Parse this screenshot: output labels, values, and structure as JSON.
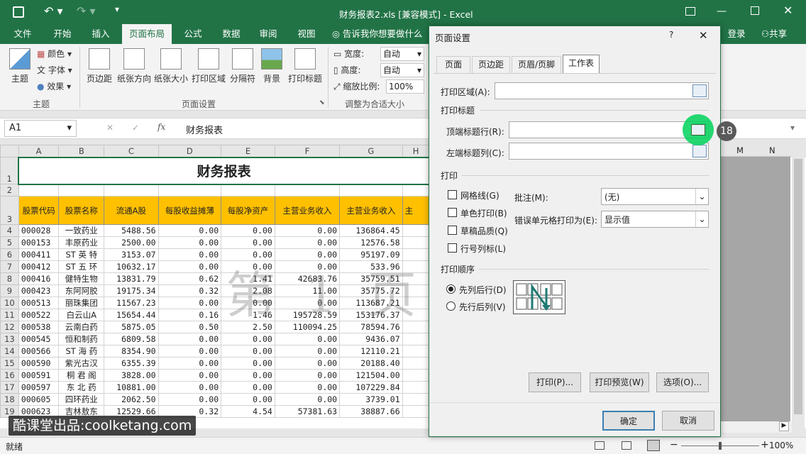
{
  "window": {
    "title": "财务报表2.xls  [兼容模式] - Excel"
  },
  "tabs": [
    "文件",
    "开始",
    "插入",
    "页面布局",
    "公式",
    "数据",
    "审阅",
    "视图"
  ],
  "tell_me": "告诉我你想要做什么",
  "login": "登录",
  "share": "共享",
  "ribbon": {
    "theme": {
      "themes": "主题",
      "colors": "颜色",
      "fonts": "字体",
      "effects": "效果",
      "group": "主题"
    },
    "page_setup": {
      "margins": "页边距",
      "orientation": "纸张方向",
      "size": "纸张大小",
      "print_area": "打印区域",
      "breaks": "分隔符",
      "background": "背景",
      "print_titles": "打印标题",
      "group": "页面设置"
    },
    "scale": {
      "width_label": "宽度:",
      "width_value": "自动",
      "height_label": "高度:",
      "height_value": "自动",
      "scale_label": "缩放比例:",
      "scale_value": "100%",
      "group": "调整为合适大小"
    }
  },
  "formula": {
    "name_box": "A1",
    "fx": "fx",
    "content": "财务报表"
  },
  "sheet": {
    "columns": [
      "A",
      "B",
      "C",
      "D",
      "E",
      "F",
      "G",
      "H"
    ],
    "title": "财务报表",
    "headers": [
      "股票代码",
      "股票名称",
      "流通A股",
      "每股收益摊薄",
      "每股净资产",
      "主营业务收入",
      "主营业务收入",
      "主"
    ],
    "rows": [
      {
        "n": "4",
        "c": [
          "000028",
          "一致药业",
          "5488.56",
          "0.00",
          "0.00",
          "0.00",
          "136864.45"
        ]
      },
      {
        "n": "5",
        "c": [
          "000153",
          "丰原药业",
          "2500.00",
          "0.00",
          "0.00",
          "0.00",
          "12576.58"
        ]
      },
      {
        "n": "6",
        "c": [
          "000411",
          "ST 英 特",
          "3153.07",
          "0.00",
          "0.00",
          "0.00",
          "95197.09"
        ]
      },
      {
        "n": "7",
        "c": [
          "000412",
          "ST 五 环",
          "10632.17",
          "0.00",
          "0.00",
          "0.00",
          "533.96"
        ]
      },
      {
        "n": "8",
        "c": [
          "000416",
          "健特生物",
          "13831.79",
          "0.62",
          "1.41",
          "42683.76",
          "35759.51"
        ]
      },
      {
        "n": "9",
        "c": [
          "000423",
          "东阿阿胶",
          "19175.34",
          "0.32",
          "2.08",
          "11.00",
          "35775.72"
        ]
      },
      {
        "n": "10",
        "c": [
          "000513",
          "丽珠集团",
          "11567.23",
          "0.00",
          "0.00",
          "0.00",
          "113687.21"
        ]
      },
      {
        "n": "11",
        "c": [
          "000522",
          "白云山A",
          "15654.44",
          "0.16",
          "1.46",
          "195728.59",
          "153176.37"
        ]
      },
      {
        "n": "12",
        "c": [
          "000538",
          "云南白药",
          "5875.05",
          "0.50",
          "2.50",
          "110094.25",
          "78594.76"
        ]
      },
      {
        "n": "13",
        "c": [
          "000545",
          "恒和制药",
          "6809.58",
          "0.00",
          "0.00",
          "0.00",
          "9436.07"
        ]
      },
      {
        "n": "14",
        "c": [
          "000566",
          "ST 海 药",
          "8354.90",
          "0.00",
          "0.00",
          "0.00",
          "12110.21"
        ]
      },
      {
        "n": "15",
        "c": [
          "000590",
          "紫光古汉",
          "6355.39",
          "0.00",
          "0.00",
          "0.00",
          "20188.40"
        ]
      },
      {
        "n": "16",
        "c": [
          "000591",
          "桐 君 阁",
          "3828.00",
          "0.00",
          "0.00",
          "0.00",
          "121504.00"
        ]
      },
      {
        "n": "17",
        "c": [
          "000597",
          "东 北 药",
          "10881.00",
          "0.00",
          "0.00",
          "0.00",
          "107229.84"
        ]
      },
      {
        "n": "18",
        "c": [
          "000605",
          "四环药业",
          "2062.50",
          "0.00",
          "0.00",
          "0.00",
          "3739.01"
        ]
      },
      {
        "n": "19",
        "c": [
          "000623",
          "吉林敖东",
          "12529.66",
          "0.32",
          "4.54",
          "57381.63",
          "38887.66"
        ]
      }
    ],
    "watermark": "第 1 页"
  },
  "right_cols": [
    "M",
    "N"
  ],
  "dialog": {
    "title": "页面设置",
    "help": "?",
    "close": "✕",
    "tabs": [
      "页面",
      "页边距",
      "页眉/页脚",
      "工作表"
    ],
    "print_area": "打印区域(A):",
    "print_titles": "打印标题",
    "rows_repeat": "顶端标题行(R):",
    "cols_repeat": "左端标题列(C):",
    "print": "打印",
    "gridlines": "网格线(G)",
    "bw": "单色打印(B)",
    "draft": "草稿品质(Q)",
    "headings": "行号列标(L)",
    "comments_label": "批注(M):",
    "comments_value": "(无)",
    "errors_label": "错误单元格打印为(E):",
    "errors_value": "显示值",
    "order": "打印顺序",
    "down_then_over": "先列后行(D)",
    "over_then_down": "先行后列(V)",
    "btn_print": "打印(P)...",
    "btn_preview": "打印预览(W)",
    "btn_options": "选项(O)...",
    "ok": "确定",
    "cancel": "取消"
  },
  "step_badge": "18",
  "status": {
    "ready": "就绪",
    "zoom": "100%"
  },
  "brand": "酷课堂出品:coolketang.com"
}
